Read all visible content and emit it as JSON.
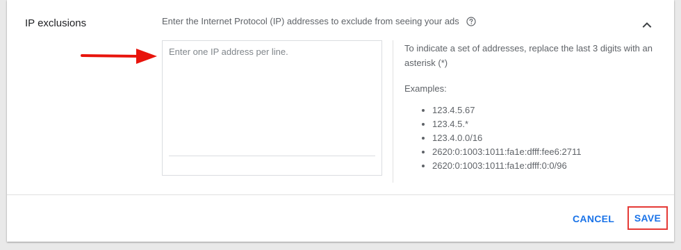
{
  "section": {
    "title": "IP exclusions",
    "description": "Enter the Internet Protocol (IP) addresses to exclude from seeing your ads"
  },
  "icons": {
    "help": "help-circle-icon",
    "collapse": "chevron-up-icon",
    "annotation": "red-arrow-icon"
  },
  "input": {
    "placeholder": "Enter one IP address per line.",
    "value": ""
  },
  "hint": {
    "text": "To indicate a set of addresses, replace the last 3 digits with an asterisk (*)",
    "examples_label": "Examples:",
    "examples": [
      "123.4.5.67",
      "123.4.5.*",
      "123.4.0.0/16",
      "2620:0:1003:1011:fa1e:dfff:fee6:2711",
      "2620:0:1003:1011:fa1e:dfff:0:0/96"
    ]
  },
  "actions": {
    "cancel_label": "CANCEL",
    "save_label": "SAVE"
  },
  "colors": {
    "accent": "#1a73e8",
    "highlight": "#e53935",
    "arrow": "#e8140c"
  }
}
